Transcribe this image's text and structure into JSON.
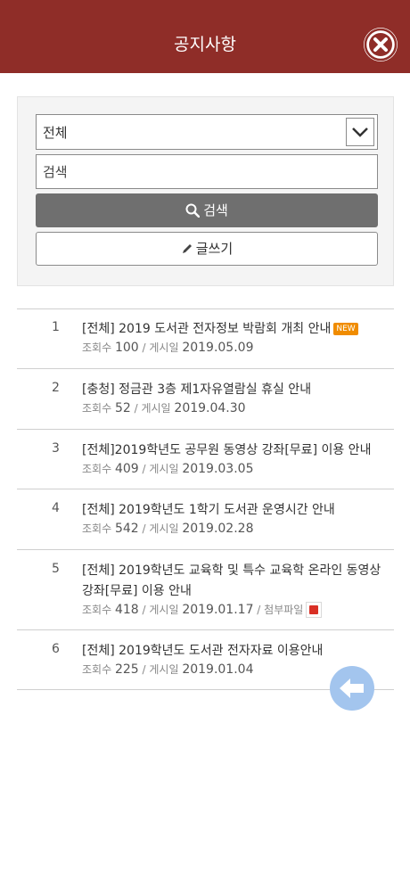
{
  "header": {
    "title": "공지사항",
    "close_icon": "close-icon"
  },
  "search": {
    "category_value": "전체",
    "input_placeholder": "검색",
    "search_label": "검색",
    "write_label": "글쓰기"
  },
  "notices": [
    {
      "num": "1",
      "title": "[전체] 2019 도서관 전자정보 박람회 개최 안내",
      "badge": "NEW",
      "views_label": "조회수",
      "views": "100",
      "date_label": "게시일",
      "date": "2019.05.09"
    },
    {
      "num": "2",
      "title": "[충청] 정금관 3층 제1자유열람실 휴실 안내",
      "views_label": "조회수",
      "views": "52",
      "date_label": "게시일",
      "date": "2019.04.30"
    },
    {
      "num": "3",
      "title": "[전체]2019학년도 공무원 동영상 강좌[무료] 이용 안내",
      "views_label": "조회수",
      "views": "409",
      "date_label": "게시일",
      "date": "2019.03.05"
    },
    {
      "num": "4",
      "title": "[전체] 2019학년도 1학기 도서관 운영시간 안내",
      "views_label": "조회수",
      "views": "542",
      "date_label": "게시일",
      "date": "2019.02.28"
    },
    {
      "num": "5",
      "title": "[전체] 2019학년도 교육학 및 특수 교육학 온라인 동영상 강좌[무료] 이용 안내",
      "views_label": "조회수",
      "views": "418",
      "date_label": "게시일",
      "date": "2019.01.17",
      "attach_label": "첨부파일"
    },
    {
      "num": "6",
      "title": "[전체] 2019학년도 도서관 전자자료 이용안내",
      "views_label": "조회수",
      "views": "225",
      "date_label": "게시일",
      "date": "2019.01.04"
    }
  ],
  "colors": {
    "header": "#8f2d28",
    "search_button": "#6f6f6f",
    "badge": "#f08c00",
    "back_button": "#a3c5ee"
  }
}
